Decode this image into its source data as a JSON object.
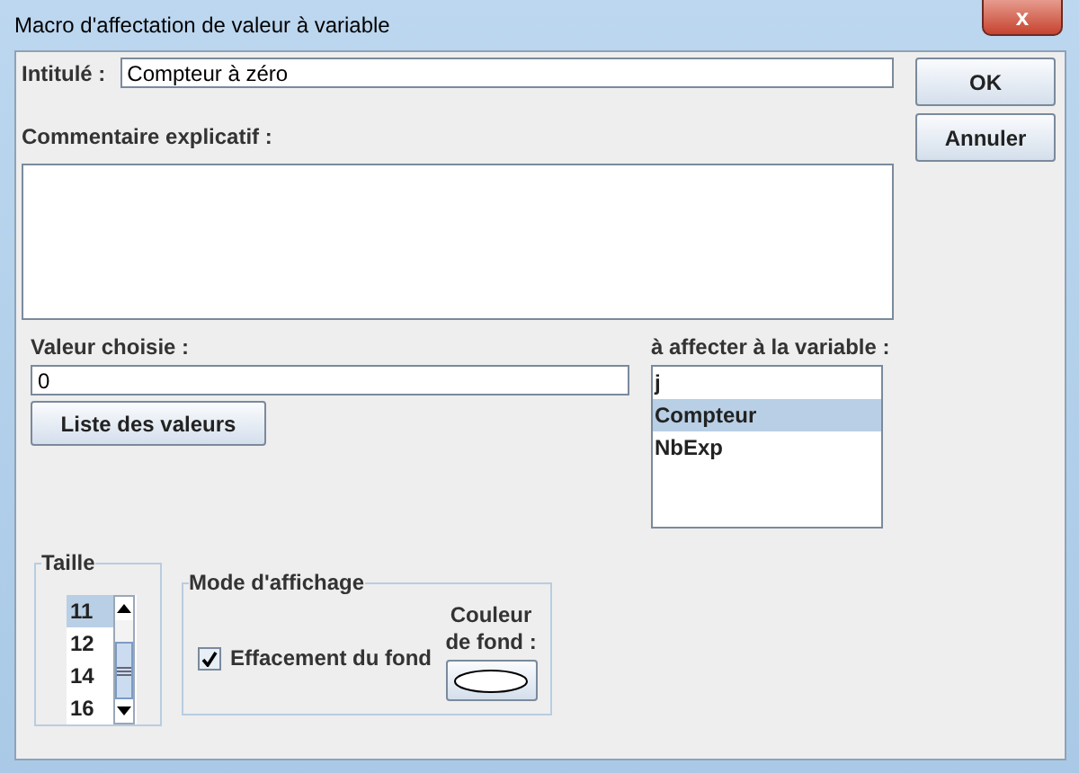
{
  "window": {
    "title": "Macro d'affectation de valeur à variable",
    "close": "x"
  },
  "title_field": {
    "label": "Intitulé :",
    "value": "Compteur à zéro"
  },
  "comment": {
    "label": "Commentaire explicatif :"
  },
  "buttons": [
    "OK",
    "Annuler"
  ],
  "value": {
    "label": "Valeur choisie :",
    "value": "0",
    "button": "Liste des valeurs"
  },
  "variables": {
    "label": "à affecter à la variable :",
    "items": [
      {
        "label": "j",
        "selected": false
      },
      {
        "label": "Compteur",
        "selected": true
      },
      {
        "label": "NbExp",
        "selected": false
      }
    ]
  },
  "size": {
    "legend": "Taille",
    "items": [
      {
        "label": "11",
        "selected": true
      },
      {
        "label": "12",
        "selected": false
      },
      {
        "label": "14",
        "selected": false
      },
      {
        "label": "16",
        "selected": false
      }
    ]
  },
  "display": {
    "legend": "Mode d'affichage",
    "checkbox": {
      "label": "Effacement du fond",
      "checked": true
    },
    "color_label": "Couleur de fond :"
  }
}
